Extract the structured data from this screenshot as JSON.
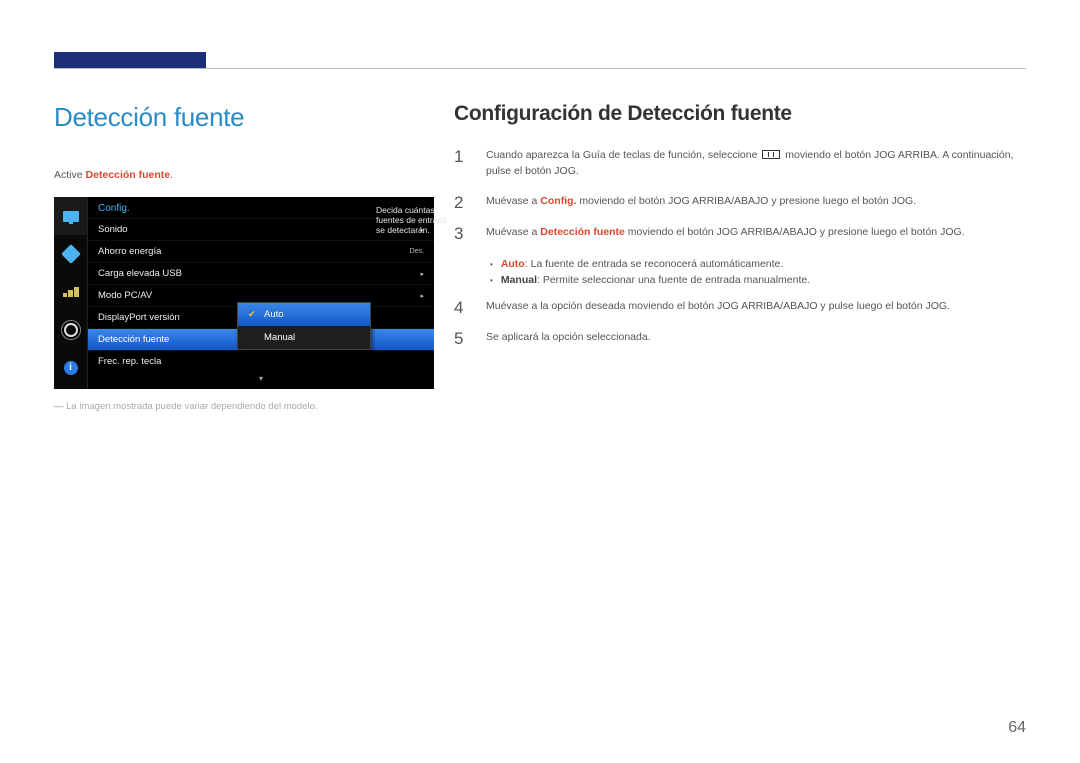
{
  "page_number": "64",
  "left": {
    "title": "Detección fuente",
    "intro_prefix": "Active ",
    "intro_bold": "Detección fuente",
    "intro_suffix": ".",
    "caption": "La imagen mostrada puede variar dependiendo del modelo."
  },
  "osd": {
    "header": "Config.",
    "items": [
      {
        "label": "Sonido",
        "right": "▸"
      },
      {
        "label": "Ahorro energía",
        "right": "Des."
      },
      {
        "label": "Carga elevada USB",
        "right": "▸"
      },
      {
        "label": "Modo PC/AV",
        "right": "▸"
      },
      {
        "label": "DisplayPort versión",
        "right": ""
      },
      {
        "label": "Detección fuente",
        "right": ""
      },
      {
        "label": "Frec. rep. tecla",
        "right": ""
      }
    ],
    "submenu": [
      {
        "label": "Auto",
        "checked": true
      },
      {
        "label": "Manual",
        "checked": false
      }
    ],
    "desc": "Decida cuántas fuentes de entrada se detectarán.",
    "down_arrow": "▾"
  },
  "right": {
    "title": "Configuración de Detección fuente",
    "step1_a": "Cuando aparezca la Guía de teclas de función, seleccione ",
    "step1_b": " moviendo el botón JOG ARRIBA. A continuación, pulse el botón JOG.",
    "step2_a": "Muévase a ",
    "step2_bold": "Config.",
    "step2_b": " moviendo el botón JOG ARRIBA/ABAJO y presione luego el botón JOG.",
    "step3_a": "Muévase a ",
    "step3_bold": "Detección fuente",
    "step3_b": " moviendo el botón JOG ARRIBA/ABAJO y presione luego el botón JOG.",
    "bullet1_bold": "Auto",
    "bullet1_text": ": La fuente de entrada se reconocerá automáticamente.",
    "bullet2_bold": "Manual",
    "bullet2_text": ": Permite seleccionar una fuente de entrada manualmente.",
    "step4": "Muévase a la opción deseada moviendo el botón JOG ARRIBA/ABAJO y pulse luego el botón JOG.",
    "step5": "Se aplicará la opción seleccionada."
  }
}
